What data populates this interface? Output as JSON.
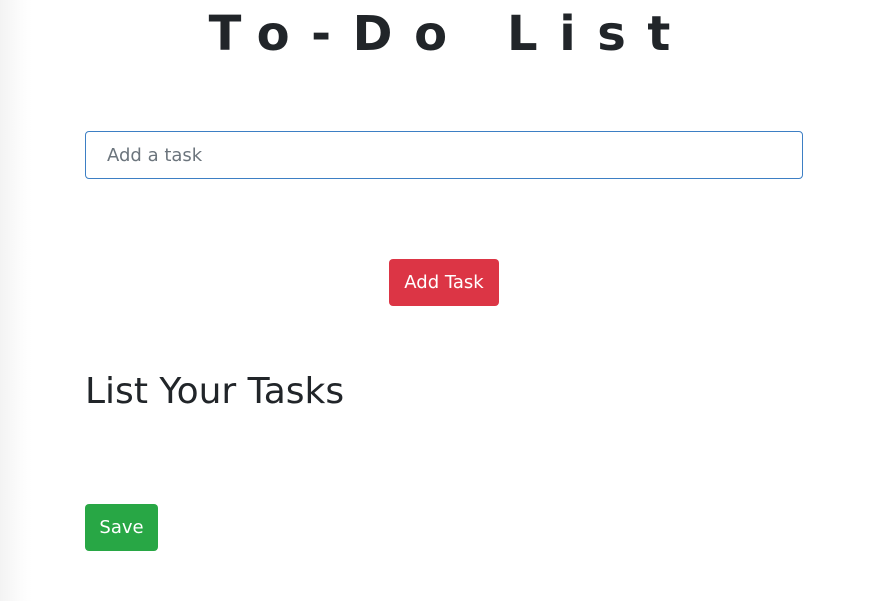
{
  "header": {
    "title": "To-Do List"
  },
  "task_form": {
    "input_value": "",
    "input_placeholder": "Add a task",
    "add_button_label": "Add Task"
  },
  "tasks_section": {
    "heading": "List Your Tasks",
    "items": []
  },
  "footer": {
    "save_button_label": "Save"
  },
  "colors": {
    "add_button": "#dc3545",
    "save_button": "#28a745",
    "input_border_focus": "#3d7fc4",
    "text": "#212529"
  }
}
